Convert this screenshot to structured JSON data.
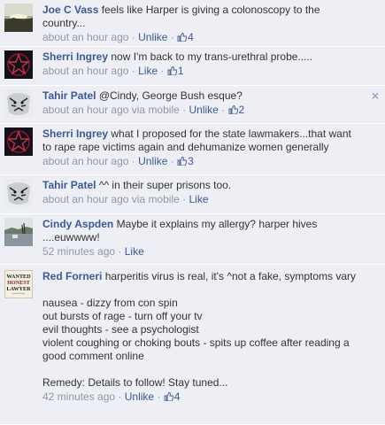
{
  "comments": [
    {
      "author": "Joe C Vass",
      "text": "feels like Harper is giving a colonoscopy to the country...",
      "time": "about an hour ago",
      "via": "",
      "action": "Unlike",
      "likes": "4",
      "avatar": "landscape-avatar"
    },
    {
      "author": "Sherri Ingrey",
      "text": "now I'm back to my trans-urethral probe.....",
      "time": "about an hour ago",
      "via": "",
      "action": "Like",
      "likes": "1",
      "avatar": "red-star-avatar"
    },
    {
      "author": "Tahir Patel",
      "text": "@Cindy, George Bush esque?",
      "time": "about an hour ago",
      "via": "via mobile",
      "action": "Unlike",
      "likes": "2",
      "avatar": "tiger-avatar",
      "close": "×"
    },
    {
      "author": "Sherri Ingrey",
      "text": "what I proposed for the state lawmakers...that want to rape rape victims again and dehumanize women generally",
      "time": "about an hour ago",
      "via": "",
      "action": "Unlike",
      "likes": "3",
      "avatar": "red-star-avatar"
    },
    {
      "author": "Tahir Patel",
      "text": "^^ in their super prisons too.",
      "time": "about an hour ago",
      "via": "via mobile",
      "action": "Like",
      "likes": "",
      "avatar": "tiger-avatar"
    },
    {
      "author": "Cindy Aspden",
      "text": "Maybe it explains my allergy? harper hives ....euwwww!",
      "time": "52 minutes ago",
      "via": "",
      "action": "Like",
      "likes": "",
      "avatar": "lake-avatar"
    },
    {
      "author": "Red Forneri",
      "text": "harperitis virus is real, it's ^not a fake, symptoms vary",
      "lines": [
        "nausea - dizzy from con spin",
        "out bursts of rage - turn off your tv",
        "evil thoughts - see a psychologist",
        "violent coughing or choking bouts - spits up coffee after reading a good comment online"
      ],
      "remedy": "Remedy: Details to follow! Stay tuned...",
      "time": "42 minutes ago",
      "via": "",
      "action": "Unlike",
      "likes": "4",
      "avatar": "wanted-poster-avatar",
      "avatar_text": [
        "WANTED",
        "HONEST",
        "LAWYER"
      ]
    }
  ],
  "separator": "·",
  "colors": {
    "link": "#3b5998",
    "meta": "#8f97a6",
    "bg": "#edeff4"
  }
}
